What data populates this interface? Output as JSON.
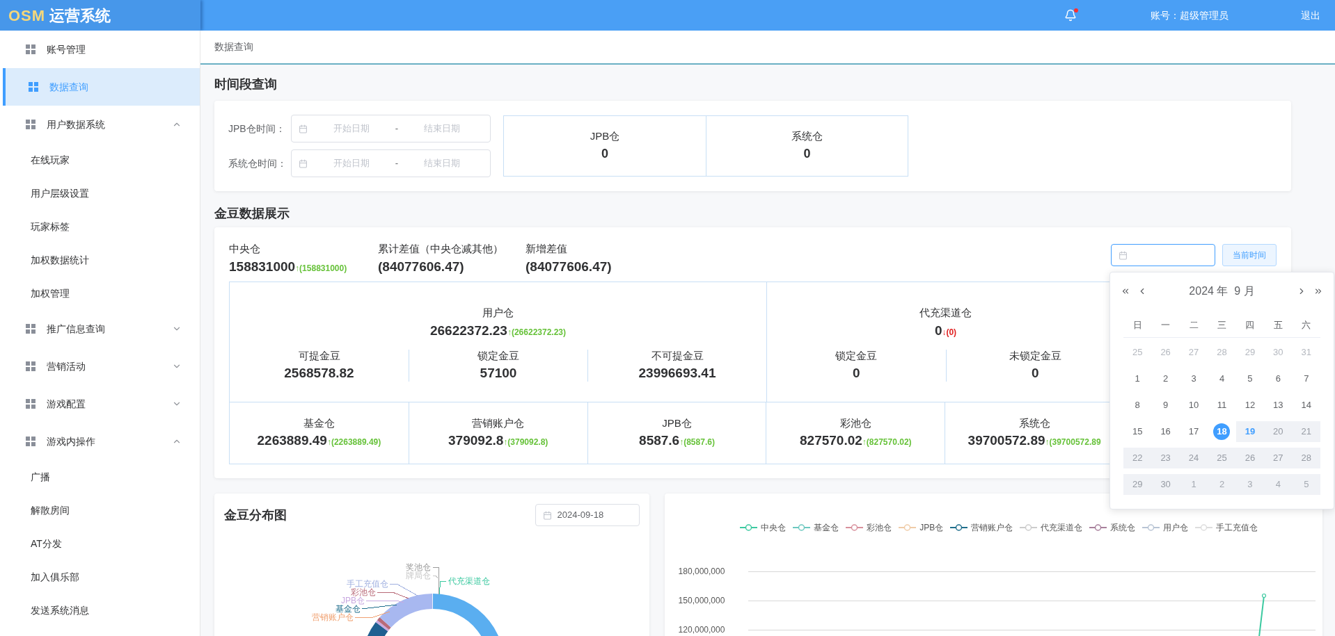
{
  "app": {
    "logo_prefix": "OSM",
    "logo_title": "运营系统"
  },
  "header": {
    "notification_dot": true,
    "account": "账号：超级管理员",
    "logout": "退出"
  },
  "sidebar": {
    "items": [
      {
        "kind": "link",
        "label": "账号管理",
        "selected": false
      },
      {
        "kind": "link",
        "label": "数据查询",
        "selected": true
      },
      {
        "kind": "group",
        "label": "用户数据系统",
        "selected": false,
        "expanded": true,
        "children": [
          {
            "label": "在线玩家",
            "selected": false
          },
          {
            "label": "用户层级设置",
            "selected": false
          },
          {
            "label": "玩家标签",
            "selected": false
          },
          {
            "label": "加权数据统计",
            "selected": false
          },
          {
            "label": "加权管理",
            "selected": false
          }
        ]
      },
      {
        "kind": "group",
        "label": "推广信息查询",
        "selected": false,
        "expanded": false
      },
      {
        "kind": "group",
        "label": "营销活动",
        "selected": false,
        "expanded": false
      },
      {
        "kind": "group",
        "label": "游戏配置",
        "selected": false,
        "expanded": false
      },
      {
        "kind": "group",
        "label": "游戏内操作",
        "selected": false,
        "expanded": true,
        "children": [
          {
            "label": "广播",
            "selected": false
          },
          {
            "label": "解散房间",
            "selected": false
          },
          {
            "label": "AT分发",
            "selected": false
          },
          {
            "label": "加入俱乐部",
            "selected": false
          },
          {
            "label": "发送系统消息",
            "selected": false
          }
        ]
      }
    ]
  },
  "breadcrumb": "数据查询",
  "time_query": {
    "title": "时间段查询",
    "ranges": [
      {
        "label": "JPB仓时间：",
        "start_placeholder": "开始日期",
        "separator": "-",
        "end_placeholder": "结束日期"
      },
      {
        "label": "系统仓时间：",
        "start_placeholder": "开始日期",
        "separator": "-",
        "end_placeholder": "结束日期"
      }
    ],
    "stats": [
      {
        "label": "JPB仓",
        "value": "0"
      },
      {
        "label": "系统仓",
        "value": "0"
      }
    ]
  },
  "gold": {
    "title": "金豆数据展示",
    "summary": [
      {
        "label": "中央仓",
        "value": "158831000",
        "delta": "↑(158831000)",
        "negative": false
      },
      {
        "label": "累计差值（中央仓减其他）",
        "value": "(84077606.47)"
      },
      {
        "label": "新增差值",
        "value": "(84077606.47)"
      }
    ],
    "date_field": {
      "focused": true
    },
    "current_time_button": "当前时间",
    "groups": [
      {
        "label": "用户仓",
        "value": "26622372.23",
        "delta": "↑(26622372.23)",
        "negative": false,
        "items": [
          {
            "label": "可提金豆",
            "value": "2568578.82"
          },
          {
            "label": "锁定金豆",
            "value": "57100"
          },
          {
            "label": "不可提金豆",
            "value": "23996693.41"
          }
        ]
      },
      {
        "label": "代充渠道仓",
        "value": "0",
        "delta": "↓(0)",
        "negative": true,
        "items": [
          {
            "label": "锁定金豆",
            "value": "0"
          },
          {
            "label": "未锁定金豆",
            "value": "0"
          }
        ]
      }
    ],
    "cells": [
      {
        "label": "基金仓",
        "value": "2263889.49",
        "delta": "↑(2263889.49)",
        "negative": false
      },
      {
        "label": "营销账户仓",
        "value": "379092.8",
        "delta": "↑(379092.8)",
        "negative": false
      },
      {
        "label": "JPB仓",
        "value": "8587.6",
        "delta": "↑(8587.6)",
        "negative": false
      },
      {
        "label": "彩池仓",
        "value": "827570.02",
        "delta": "↑(827570.02)",
        "negative": false
      },
      {
        "label": "系统仓",
        "value": "39700572.89",
        "delta": "↑(39700572.89",
        "negative": false
      }
    ]
  },
  "calendar": {
    "title": "2024 年  9 月",
    "weekdays": [
      "日",
      "一",
      "二",
      "三",
      "四",
      "五",
      "六"
    ],
    "weeks": [
      [
        {
          "day": "25",
          "other_month": true,
          "disabled": false,
          "selected": false,
          "today": false
        },
        {
          "day": "26",
          "other_month": true,
          "disabled": false,
          "selected": false,
          "today": false
        },
        {
          "day": "27",
          "other_month": true,
          "disabled": false,
          "selected": false,
          "today": false
        },
        {
          "day": "28",
          "other_month": true,
          "disabled": false,
          "selected": false,
          "today": false
        },
        {
          "day": "29",
          "other_month": true,
          "disabled": false,
          "selected": false,
          "today": false
        },
        {
          "day": "30",
          "other_month": true,
          "disabled": false,
          "selected": false,
          "today": false
        },
        {
          "day": "31",
          "other_month": true,
          "disabled": false,
          "selected": false,
          "today": false
        }
      ],
      [
        {
          "day": "1",
          "other_month": false,
          "disabled": false,
          "selected": false,
          "today": false
        },
        {
          "day": "2",
          "other_month": false,
          "disabled": false,
          "selected": false,
          "today": false
        },
        {
          "day": "3",
          "other_month": false,
          "disabled": false,
          "selected": false,
          "today": false
        },
        {
          "day": "4",
          "other_month": false,
          "disabled": false,
          "selected": false,
          "today": false
        },
        {
          "day": "5",
          "other_month": false,
          "disabled": false,
          "selected": false,
          "today": false
        },
        {
          "day": "6",
          "other_month": false,
          "disabled": false,
          "selected": false,
          "today": false
        },
        {
          "day": "7",
          "other_month": false,
          "disabled": false,
          "selected": false,
          "today": false
        }
      ],
      [
        {
          "day": "8",
          "other_month": false,
          "disabled": false,
          "selected": false,
          "today": false
        },
        {
          "day": "9",
          "other_month": false,
          "disabled": false,
          "selected": false,
          "today": false
        },
        {
          "day": "10",
          "other_month": false,
          "disabled": false,
          "selected": false,
          "today": false
        },
        {
          "day": "11",
          "other_month": false,
          "disabled": false,
          "selected": false,
          "today": false
        },
        {
          "day": "12",
          "other_month": false,
          "disabled": false,
          "selected": false,
          "today": false
        },
        {
          "day": "13",
          "other_month": false,
          "disabled": false,
          "selected": false,
          "today": false
        },
        {
          "day": "14",
          "other_month": false,
          "disabled": false,
          "selected": false,
          "today": false
        }
      ],
      [
        {
          "day": "15",
          "other_month": false,
          "disabled": false,
          "selected": false,
          "today": false
        },
        {
          "day": "16",
          "other_month": false,
          "disabled": false,
          "selected": false,
          "today": false
        },
        {
          "day": "17",
          "other_month": false,
          "disabled": false,
          "selected": false,
          "today": false
        },
        {
          "day": "18",
          "other_month": false,
          "disabled": false,
          "selected": true,
          "today": false
        },
        {
          "day": "19",
          "other_month": false,
          "disabled": true,
          "selected": false,
          "today": true
        },
        {
          "day": "20",
          "other_month": false,
          "disabled": true,
          "selected": false,
          "today": false
        },
        {
          "day": "21",
          "other_month": false,
          "disabled": true,
          "selected": false,
          "today": false
        }
      ],
      [
        {
          "day": "22",
          "other_month": false,
          "disabled": true,
          "selected": false,
          "today": false
        },
        {
          "day": "23",
          "other_month": false,
          "disabled": true,
          "selected": false,
          "today": false
        },
        {
          "day": "24",
          "other_month": false,
          "disabled": true,
          "selected": false,
          "today": false
        },
        {
          "day": "25",
          "other_month": false,
          "disabled": true,
          "selected": false,
          "today": false
        },
        {
          "day": "26",
          "other_month": false,
          "disabled": true,
          "selected": false,
          "today": false
        },
        {
          "day": "27",
          "other_month": false,
          "disabled": true,
          "selected": false,
          "today": false
        },
        {
          "day": "28",
          "other_month": false,
          "disabled": true,
          "selected": false,
          "today": false
        }
      ],
      [
        {
          "day": "29",
          "other_month": false,
          "disabled": true,
          "selected": false,
          "today": false
        },
        {
          "day": "30",
          "other_month": false,
          "disabled": true,
          "selected": false,
          "today": false
        },
        {
          "day": "1",
          "other_month": true,
          "disabled": true,
          "selected": false,
          "today": false
        },
        {
          "day": "2",
          "other_month": true,
          "disabled": true,
          "selected": false,
          "today": false
        },
        {
          "day": "3",
          "other_month": true,
          "disabled": true,
          "selected": false,
          "today": false
        },
        {
          "day": "4",
          "other_month": true,
          "disabled": true,
          "selected": false,
          "today": false
        },
        {
          "day": "5",
          "other_month": true,
          "disabled": true,
          "selected": false,
          "today": false
        }
      ]
    ]
  },
  "distribution": {
    "title": "金豆分布图",
    "date": "2024-09-18",
    "labels": [
      {
        "text": "奖池仓",
        "color": "#9a9a9a"
      },
      {
        "text": "牌局仓",
        "color": "#c8c8c8"
      },
      {
        "text": "代充渠道仓",
        "color": "#3cc9a0"
      },
      {
        "text": "手工充值仓",
        "color": "#a0b0e0"
      },
      {
        "text": "彩池仓",
        "color": "#b86a78"
      },
      {
        "text": "JPB仓",
        "color": "#c8a8e0"
      },
      {
        "text": "基金仓",
        "color": "#1f6e8c"
      },
      {
        "text": "营销账户仓",
        "color": "#f0a070"
      }
    ]
  },
  "trend_chart": {
    "legend": [
      {
        "label": "中央仓",
        "color": "#3cc9a0"
      },
      {
        "label": "基金仓",
        "color": "#6cc8c0"
      },
      {
        "label": "彩池仓",
        "color": "#d8909c"
      },
      {
        "label": "JPB仓",
        "color": "#f0cca8"
      },
      {
        "label": "营销账户仓",
        "color": "#1f6e8c"
      },
      {
        "label": "代充渠道仓",
        "color": "#cccccc"
      },
      {
        "label": "系统仓",
        "color": "#a8809c"
      },
      {
        "label": "用户仓",
        "color": "#b8c4d4"
      },
      {
        "label": "手工充值仓",
        "color": "#dddddd"
      }
    ],
    "y_axis_labels": [
      "180,000,000",
      "150,000,000",
      "120,000,000"
    ]
  }
}
